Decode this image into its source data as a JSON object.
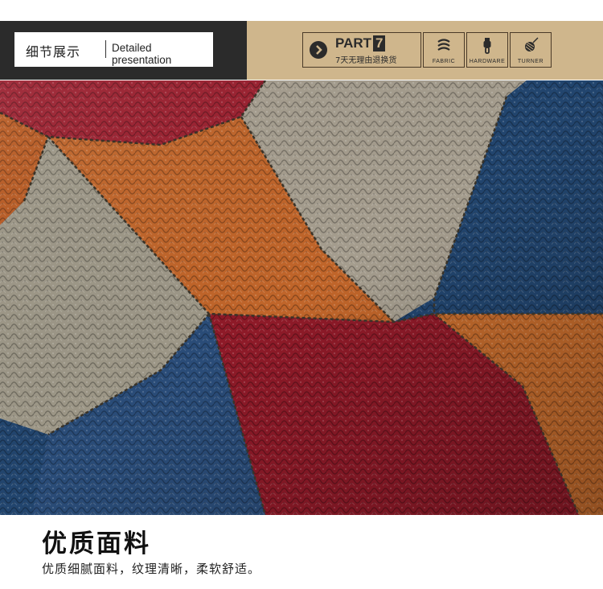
{
  "header": {
    "title_cn": "细节展示",
    "title_en": "Detailed presentation",
    "part_prefix": "PART",
    "part_number": "7",
    "part_subtitle": "7天无理由退换货",
    "features": [
      {
        "label": "FABRIC",
        "icon": "fabric-icon"
      },
      {
        "label": "HARDWARE",
        "icon": "zipper-icon"
      },
      {
        "label": "TURNER",
        "icon": "thread-spool-icon"
      }
    ]
  },
  "colors": {
    "header_dark": "#2b2b2b",
    "header_kraft": "#cfb68c",
    "leather_red": "#9a1f2e",
    "leather_orange": "#c0652a",
    "leather_gray": "#a59d8e",
    "leather_blue": "#22456e"
  },
  "caption": {
    "title": "优质面料",
    "text": "优质细腻面料，纹理清晰，柔软舒适。"
  }
}
